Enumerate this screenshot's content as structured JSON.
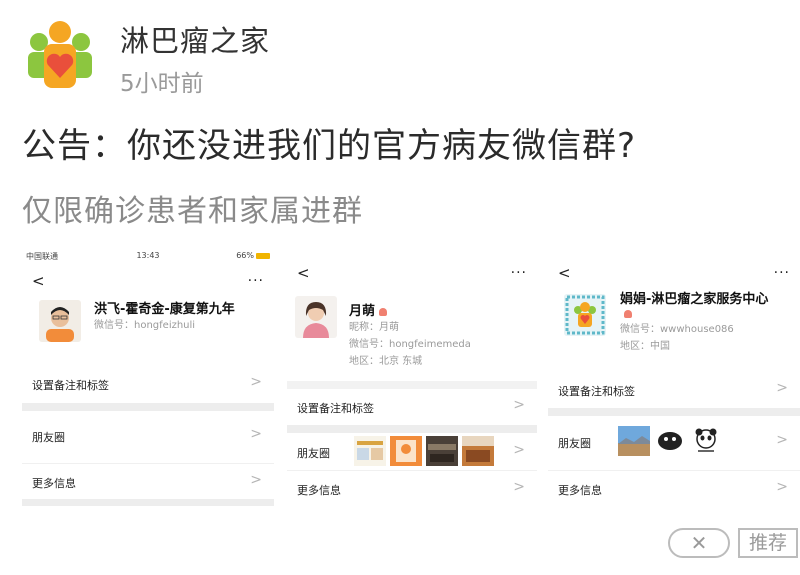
{
  "post": {
    "author": "淋巴瘤之家",
    "time": "5小时前",
    "title": "公告：你还没进我们的官方病友微信群?",
    "subtitle": "仅限确诊患者和家属进群"
  },
  "icons": {
    "logo": "family-heart-logo",
    "back": "chevron-left-icon",
    "more": "ellipsis-icon",
    "chevron": "chevron-right-icon"
  },
  "colors": {
    "brand_green": "#8cc63f",
    "brand_orange": "#f5a623",
    "heart_red": "#e94f3b"
  },
  "panels": [
    {
      "status": {
        "carrier": "中国联通",
        "time": "13:43",
        "battery": "66%"
      },
      "back": "<",
      "more": "···",
      "name": "洪飞-霍奇金-康复第九年",
      "wechat_id": "微信号：hongfeizhuli",
      "rows": [
        "设置备注和标签",
        "朋友圈",
        "更多信息"
      ],
      "chevron": ">"
    },
    {
      "back": "<",
      "more": "···",
      "name": "月萌",
      "nickname": "昵称：月萌",
      "wechat_id": "微信号：hongfeimemeda",
      "region": "地区：北京  东城",
      "rows": [
        "设置备注和标签",
        "朋友圈",
        "更多信息"
      ],
      "chevron": ">"
    },
    {
      "back": "<",
      "more": "···",
      "name": "娟娟-淋巴瘤之家服务中心",
      "wechat_id": "微信号：wwwhouse086",
      "region": "地区：中国",
      "rows": [
        "设置备注和标签",
        "朋友圈",
        "更多信息"
      ],
      "chevron": ">"
    }
  ],
  "actions": {
    "close": "✕",
    "recommend": "推荐"
  }
}
